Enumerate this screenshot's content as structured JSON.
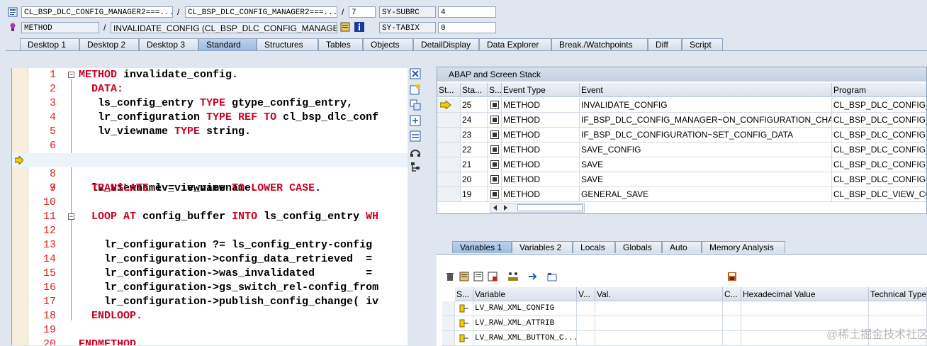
{
  "header": {
    "row1": {
      "program1": "CL_BSP_DLC_CONFIG_MANAGER2===...",
      "program2": "CL_BSP_DLC_CONFIG_MANAGER2===...",
      "line": "7",
      "sys_var": "SY-SUBRC",
      "sys_val": "4"
    },
    "row2": {
      "type": "METHOD",
      "name": "INVALIDATE_CONFIG (CL_BSP_DLC_CONFIG_MANAGER...",
      "sys_var": "SY-TABIX",
      "sys_val": "0"
    },
    "slash": "/"
  },
  "tabs": [
    "Desktop 1",
    "Desktop 2",
    "Desktop 3",
    "Standard",
    "Structures",
    "Tables",
    "Objects",
    "DetailDisplay",
    "Data Explorer",
    "Break./Watchpoints",
    "Diff",
    "Script"
  ],
  "active_tab": "Standard",
  "code": [
    {
      "n": "1",
      "t": "METHOD invalidate_config."
    },
    {
      "n": "2",
      "t": "  DATA:"
    },
    {
      "n": "3",
      "t": "   ls_config_entry TYPE gtype_config_entry,"
    },
    {
      "n": "4",
      "t": "   lr_configuration TYPE REF TO cl_bsp_dlc_conf"
    },
    {
      "n": "5",
      "t": "   lv_viewname TYPE string."
    },
    {
      "n": "6",
      "t": ""
    },
    {
      "n": "7",
      "t": "  lv_viewname = iv_viewname."
    },
    {
      "n": "8",
      "t": ""
    },
    {
      "n": "9",
      "t": "  TRANSLATE lv_viewname TO LOWER CASE."
    },
    {
      "n": "10",
      "t": ""
    },
    {
      "n": "11",
      "t": "  LOOP AT config_buffer INTO ls_config_entry WH"
    },
    {
      "n": "12",
      "t": ""
    },
    {
      "n": "13",
      "t": "    lr_configuration ?= ls_config_entry-config"
    },
    {
      "n": "14",
      "t": "    lr_configuration->config_data_retrieved  ="
    },
    {
      "n": "15",
      "t": "    lr_configuration->was_invalidated        ="
    },
    {
      "n": "16",
      "t": "    lr_configuration->gs_switch_rel-config_from"
    },
    {
      "n": "17",
      "t": "    lr_configuration->publish_config_change( iv"
    },
    {
      "n": "18",
      "t": "  ENDLOOP."
    },
    {
      "n": "19",
      "t": ""
    },
    {
      "n": "20",
      "t": "ENDMETHOD."
    }
  ],
  "stack": {
    "title": "ABAP and Screen Stack",
    "columns": [
      "St...",
      "Sta...",
      "S...",
      "Event Type",
      "Event",
      "Program"
    ],
    "rows": [
      {
        "level": "25",
        "type": "METHOD",
        "event": "INVALIDATE_CONFIG",
        "program": "CL_BSP_DLC_CONFIG_M"
      },
      {
        "level": "24",
        "type": "METHOD",
        "event": "IF_BSP_DLC_CONFIG_MANAGER~ON_CONFIGURATION_CHAN...",
        "program": "CL_BSP_DLC_CONFIG_M"
      },
      {
        "level": "23",
        "type": "METHOD",
        "event": "IF_BSP_DLC_CONFIGURATION~SET_CONFIG_DATA",
        "program": "CL_BSP_DLC_CONFIGUR"
      },
      {
        "level": "22",
        "type": "METHOD",
        "event": "SAVE_CONFIG",
        "program": "CL_BSP_DLC_CONFIG_BA"
      },
      {
        "level": "21",
        "type": "METHOD",
        "event": "SAVE",
        "program": "CL_BSP_DLC_CONFIG_O"
      },
      {
        "level": "20",
        "type": "METHOD",
        "event": "SAVE",
        "program": "CL_BSP_DLC_CONFIG==="
      },
      {
        "level": "19",
        "type": "METHOD",
        "event": "GENERAL_SAVE",
        "program": "CL_BSP_DLC_VIEW_CON"
      }
    ]
  },
  "var_tabs": [
    "Variables 1",
    "Variables 2",
    "Locals",
    "Globals",
    "Auto",
    "Memory Analysis"
  ],
  "active_var_tab": "Variables 1",
  "variables": {
    "columns": [
      "S...",
      "Variable",
      "V...",
      "Val.",
      "C...",
      "Hexadecimal Value",
      "Technical Type"
    ],
    "rows": [
      {
        "name": "LV_RAW_XML_CONFIG"
      },
      {
        "name": "LV_RAW_XML_ATTRIB"
      },
      {
        "name": "LV_RAW_XML_BUTTON_C..."
      }
    ]
  },
  "watermark": "@稀土掘金技术社区",
  "colors": {
    "keyword": "#cc0022",
    "line_number": "#dd2222",
    "tab_active": "#9fbbe0"
  }
}
